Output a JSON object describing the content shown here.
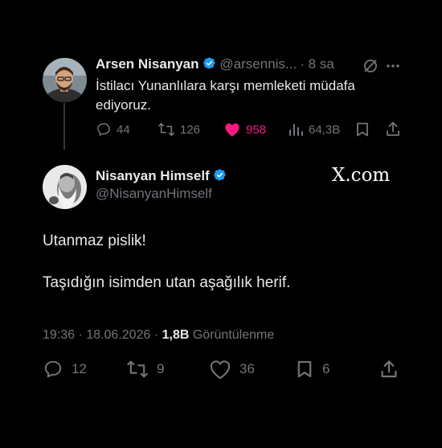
{
  "reply_tweet": {
    "author_name": "Arsen Nisanyan",
    "author_handle": "@arsennis...",
    "separator": "·",
    "time_ago": "8 sa",
    "text_line1": "İstilacı Yunanlılara karşı memleketi müdafa",
    "text_line2": "ediyoruz.",
    "stats": {
      "replies": "44",
      "reposts": "126",
      "likes": "958",
      "views": "64,3B"
    },
    "like_color": "#f91880"
  },
  "main_tweet": {
    "author_name": "Nisanyan Himself",
    "author_handle": "@NisanyanHimself",
    "watermark": "X.com",
    "text_para1": "Utanmaz pislik!",
    "text_para2": "Taşıdığın isimden utan aşağılık herif.",
    "meta": {
      "time": "19:36",
      "sep1": "·",
      "date": "18.06.2026",
      "sep2": "·",
      "views_count": "1,8B",
      "views_label": "Görüntülenme"
    },
    "actions": {
      "replies": "12",
      "reposts": "9",
      "likes": "36",
      "bookmarks": "6"
    }
  },
  "colors": {
    "background": "#000000",
    "text": "#e7e9ea",
    "muted": "#71767b",
    "verified": "#1d9bf0"
  },
  "icons": [
    "verified-badge-icon",
    "grok-icon",
    "more-icon",
    "reply-icon",
    "repost-icon",
    "like-icon",
    "views-icon",
    "bookmark-icon",
    "share-icon"
  ]
}
